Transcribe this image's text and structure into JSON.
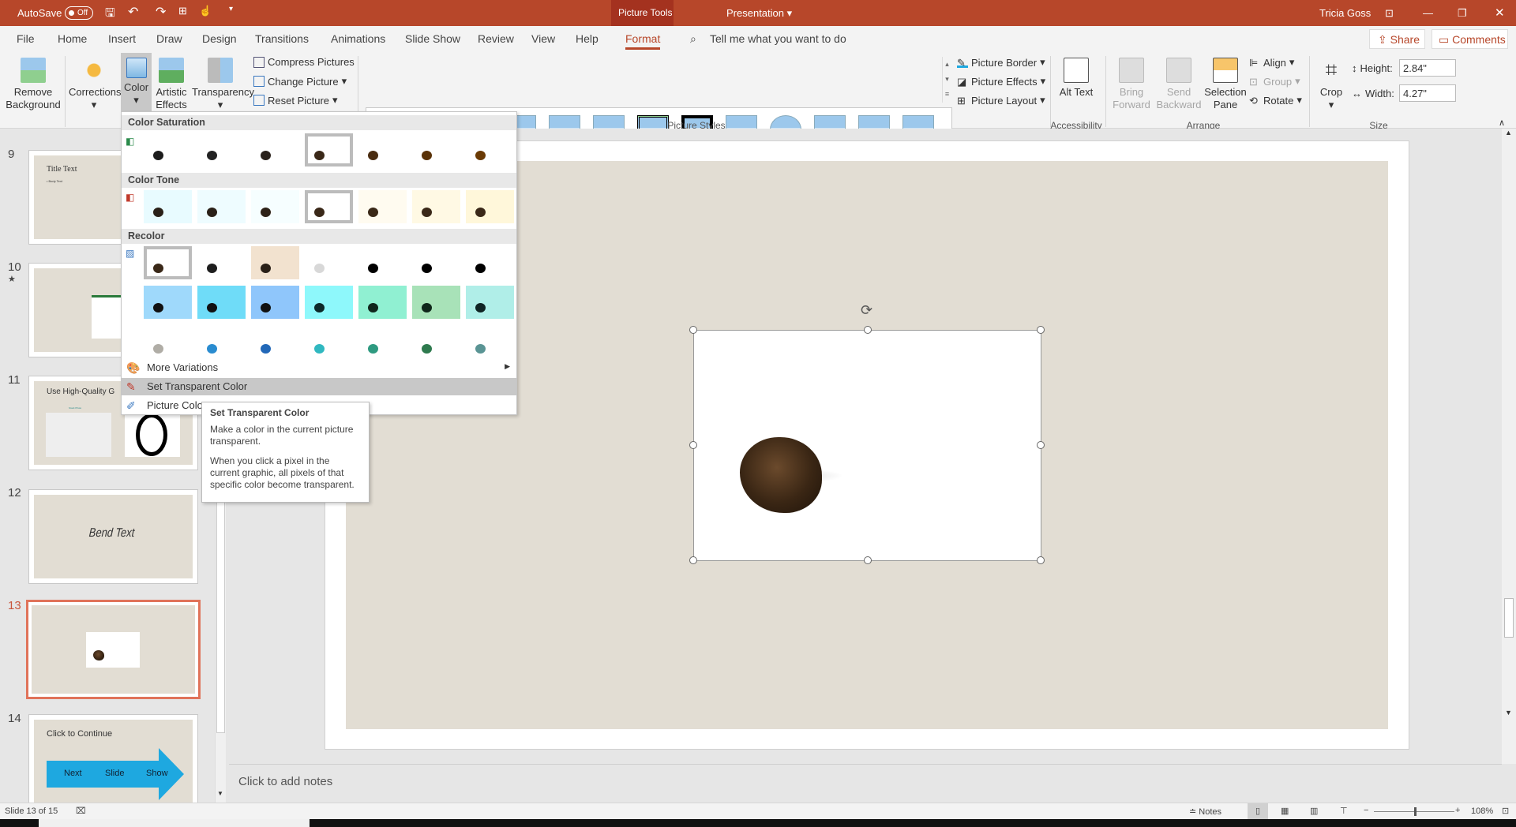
{
  "titlebar": {
    "autosave_label": "AutoSave",
    "autosave_state": "Off",
    "context_tab": "Picture Tools",
    "document_title": "Presentation",
    "user_name": "Tricia Goss",
    "icons": [
      "save-icon",
      "undo-icon",
      "redo-icon",
      "present-icon",
      "touch-mode-icon",
      "customize-icon",
      "ribbon-display-icon",
      "minimize-icon",
      "restore-icon",
      "close-icon"
    ]
  },
  "tabs": [
    {
      "label": "File"
    },
    {
      "label": "Home"
    },
    {
      "label": "Insert"
    },
    {
      "label": "Draw"
    },
    {
      "label": "Design"
    },
    {
      "label": "Transitions"
    },
    {
      "label": "Animations"
    },
    {
      "label": "Slide Show"
    },
    {
      "label": "Review"
    },
    {
      "label": "View"
    },
    {
      "label": "Help"
    },
    {
      "label": "Format",
      "active": true
    }
  ],
  "tell_me": "Tell me what you want to do",
  "share_label": "Share",
  "comments_label": "Comments",
  "ribbon": {
    "adjust": {
      "remove_background": "Remove Background",
      "corrections": "Corrections",
      "color": "Color",
      "artistic_effects": "Artistic Effects",
      "transparency": "Transparency",
      "compress": "Compress Pictures",
      "change": "Change Picture",
      "reset": "Reset Picture"
    },
    "picture_styles": {
      "label": "Picture Styles",
      "border": "Picture Border",
      "effects": "Picture Effects",
      "layout": "Picture Layout"
    },
    "accessibility": {
      "label": "Accessibility",
      "alt_text": "Alt Text"
    },
    "arrange": {
      "label": "Arrange",
      "bring_forward": "Bring Forward",
      "send_backward": "Send Backward",
      "selection_pane": "Selection Pane",
      "align": "Align",
      "group": "Group",
      "rotate": "Rotate"
    },
    "size": {
      "label": "Size",
      "crop": "Crop",
      "height_label": "Height:",
      "height_value": "2.84\"",
      "width_label": "Width:",
      "width_value": "4.27\""
    }
  },
  "color_menu": {
    "saturation_title": "Color Saturation",
    "tone_title": "Color Tone",
    "recolor_title": "Recolor",
    "saturation": [
      {
        "bg": "#ffffff",
        "fg": "#1c1c1c"
      },
      {
        "bg": "#ffffff",
        "fg": "#222"
      },
      {
        "bg": "#ffffff",
        "fg": "#2a221c"
      },
      {
        "bg": "#ffffff",
        "fg": "#3a2818",
        "selected": true
      },
      {
        "bg": "#ffffff",
        "fg": "#4a2c10"
      },
      {
        "bg": "#ffffff",
        "fg": "#5a3208"
      },
      {
        "bg": "#ffffff",
        "fg": "#6a3a04"
      }
    ],
    "tone": [
      {
        "bg": "#e8fbff",
        "fg": "#2a2018"
      },
      {
        "bg": "#eefcff",
        "fg": "#2a2018"
      },
      {
        "bg": "#f6feff",
        "fg": "#2e2218"
      },
      {
        "bg": "#ffffff",
        "fg": "#3a2818",
        "selected": true
      },
      {
        "bg": "#fffbf0",
        "fg": "#3a2818"
      },
      {
        "bg": "#fff9e4",
        "fg": "#3a2818"
      },
      {
        "bg": "#fff7da",
        "fg": "#3a2818"
      }
    ],
    "recolor": [
      {
        "bg": "#ffffff",
        "fg": "#3a2818",
        "selected": true
      },
      {
        "bg": "#ffffff",
        "fg": "#1e1e1e"
      },
      {
        "bg": "#f2e2cf",
        "fg": "#2a2018"
      },
      {
        "bg": "#ffffff",
        "fg": "#d8d8d8"
      },
      {
        "bg": "#ffffff",
        "fg": "#000000"
      },
      {
        "bg": "#ffffff",
        "fg": "#000000"
      },
      {
        "bg": "#ffffff",
        "fg": "#000000"
      },
      {
        "bg": "#9fd9fb",
        "fg": "#111"
      },
      {
        "bg": "#6fdcf8",
        "fg": "#111"
      },
      {
        "bg": "#8fc6fb",
        "fg": "#111"
      },
      {
        "bg": "#8ef8fb",
        "fg": "#0d2a2a"
      },
      {
        "bg": "#90f0d2",
        "fg": "#10261c"
      },
      {
        "bg": "#a8e2b8",
        "fg": "#10261a"
      },
      {
        "bg": "#b0eee8",
        "fg": "#102424"
      },
      {
        "bg": "#ffffff",
        "fg": "#b0ada6"
      },
      {
        "bg": "#ffffff",
        "fg": "#2a8cd0"
      },
      {
        "bg": "#ffffff",
        "fg": "#2268b8"
      },
      {
        "bg": "#ffffff",
        "fg": "#30b8c0"
      },
      {
        "bg": "#ffffff",
        "fg": "#2e9a80"
      },
      {
        "bg": "#ffffff",
        "fg": "#2e7a4e"
      },
      {
        "bg": "#ffffff",
        "fg": "#5a9494"
      }
    ],
    "more_variations": "More Variations",
    "set_transparent": "Set Transparent Color",
    "picture_color_options": "Picture Color"
  },
  "tooltip": {
    "title": "Set Transparent Color",
    "line1": "Make a color in the current picture transparent.",
    "line2": "When you click a pixel in the current graphic, all pixels of that specific color become transparent."
  },
  "slides": [
    {
      "number": "9",
      "title": "Title Text",
      "body": "• Body Text"
    },
    {
      "number": "10",
      "star": "★"
    },
    {
      "number": "11",
      "title": "Use High-Quality G",
      "caption": "Stock Photo"
    },
    {
      "number": "12",
      "wordart": "Bend Text"
    },
    {
      "number": "13",
      "selected": true
    },
    {
      "number": "14",
      "title": "Click to Continue",
      "arrow_words": [
        "Next",
        "Slide",
        "Show"
      ]
    }
  ],
  "notes_placeholder": "Click to add notes",
  "status": {
    "slide_info": "Slide 13 of 15",
    "notes": "Notes",
    "zoom": "108%",
    "zoom_level_percent": 108
  },
  "colors": {
    "accent": "#b7472a",
    "selection": "#e0735a",
    "slide_bg": "#e2ddd3",
    "arrow": "#1ea8e0"
  }
}
